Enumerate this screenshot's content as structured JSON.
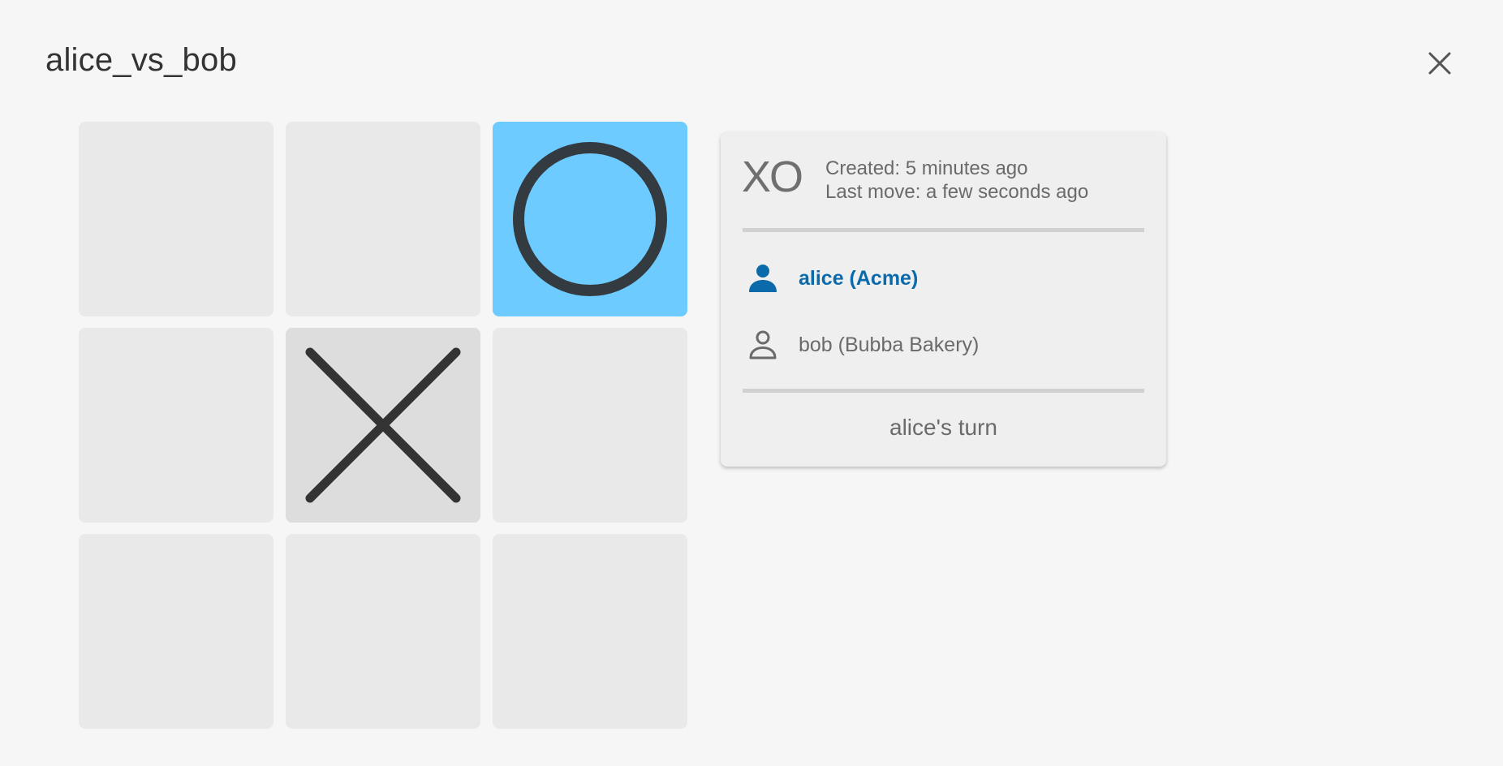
{
  "dialog": {
    "title": "alice_vs_bob",
    "close_icon": "close-icon"
  },
  "board": {
    "cells": [
      {
        "mark": "",
        "highlight": false
      },
      {
        "mark": "",
        "highlight": false
      },
      {
        "mark": "O",
        "highlight": true
      },
      {
        "mark": "",
        "highlight": false
      },
      {
        "mark": "X",
        "highlight": false
      },
      {
        "mark": "",
        "highlight": false
      },
      {
        "mark": "",
        "highlight": false
      },
      {
        "mark": "",
        "highlight": false
      },
      {
        "mark": "",
        "highlight": false
      }
    ],
    "colors": {
      "cell": "#e9e9e9",
      "highlight_cell": "#6ecbff",
      "mark": "#333a40"
    }
  },
  "card": {
    "logo": "XO",
    "created": "Created: 5 minutes ago",
    "last_move": "Last move: a few seconds ago",
    "players": [
      {
        "name": "alice (Acme)",
        "icon": "person-filled-icon",
        "active": true,
        "color": "#0b6aaa"
      },
      {
        "name": "bob (Bubba Bakery)",
        "icon": "person-outline-icon",
        "active": false,
        "color": "#6a6a6a"
      }
    ],
    "status": "alice's turn"
  }
}
